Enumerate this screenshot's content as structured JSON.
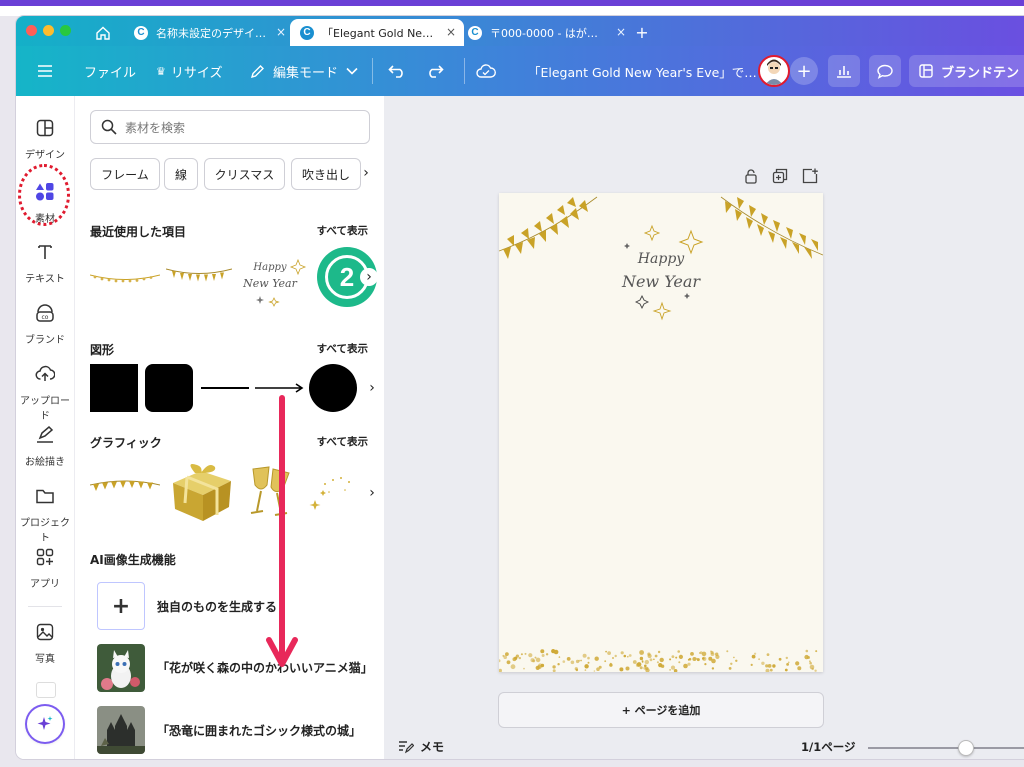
{
  "browser": {
    "tabs": [
      {
        "label": "名称未設定のデザイ…",
        "active": false
      },
      {
        "label": "「Elegant Gold Ne…",
        "active": true
      },
      {
        "label": "〒000-0000 - はが…",
        "active": false
      }
    ],
    "close_glyph": "×",
    "new_tab_glyph": "+"
  },
  "toolbar": {
    "file": "ファイル",
    "resize": "リサイズ",
    "edit_mode": "編集モード",
    "doc_title": "「Elegant Gold New Year's Eve」で…",
    "brand_template": "ブランドテン"
  },
  "rail": [
    {
      "label": "デザイン",
      "icon": "design-icon"
    },
    {
      "label": "素材",
      "icon": "elements-icon"
    },
    {
      "label": "テキスト",
      "icon": "text-icon"
    },
    {
      "label": "ブランド",
      "icon": "brand-icon"
    },
    {
      "label": "アップロード",
      "icon": "upload-icon"
    },
    {
      "label": "お絵描き",
      "icon": "draw-icon"
    },
    {
      "label": "プロジェクト",
      "icon": "folder-icon"
    },
    {
      "label": "アプリ",
      "icon": "apps-icon"
    },
    {
      "label": "写真",
      "icon": "photo-icon"
    }
  ],
  "panel": {
    "search_placeholder": "素材を検索",
    "chips": [
      "フレーム",
      "線",
      "クリスマス",
      "吹き出し"
    ],
    "recent_title": "最近使用した項目",
    "see_all": "すべて表示",
    "shapes_title": "図形",
    "graphics_title": "グラフィック",
    "ai_title": "AI画像生成機能",
    "ai_generate": "独自のものを生成する",
    "ai_items": [
      {
        "text": "「花が咲く森の中のかわいいアニメ猫」"
      },
      {
        "text": "「恐竜に囲まれたゴシック様式の城」"
      }
    ],
    "recent_badge": "2"
  },
  "canvas": {
    "card_text_line1": "Happy",
    "card_text_line2": "New Year",
    "add_page": "+ ページを追加",
    "notes": "メモ",
    "page_count": "1/1ページ"
  },
  "colors": {
    "accent_purple": "#6a3fd6",
    "teal": "#15b5c8",
    "gold": "#c9a227",
    "highlight_red": "#e01b2f",
    "arrow_pink": "#e8285a"
  }
}
